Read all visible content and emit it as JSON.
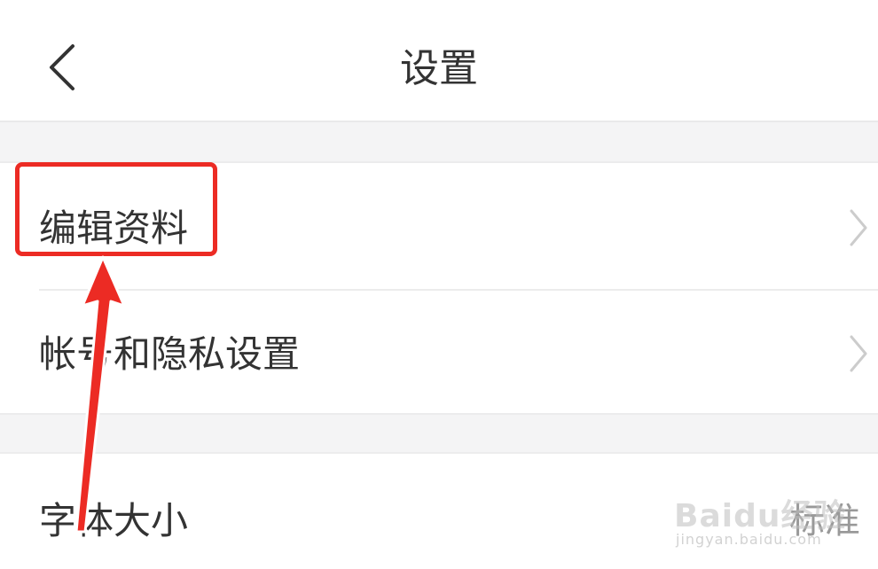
{
  "header": {
    "back_icon": "chevron-left-icon",
    "title": "设置"
  },
  "settings": {
    "items": [
      {
        "label": "编辑资料",
        "icon": "chevron-right-icon"
      },
      {
        "label": "帐号和隐私设置",
        "icon": "chevron-right-icon"
      },
      {
        "label": "字体大小",
        "value": "标准"
      }
    ]
  },
  "annotation": {
    "color": "#ec2b24"
  },
  "watermark": {
    "brand": "Baidu经验",
    "domain": "jingyan.baidu.com"
  }
}
